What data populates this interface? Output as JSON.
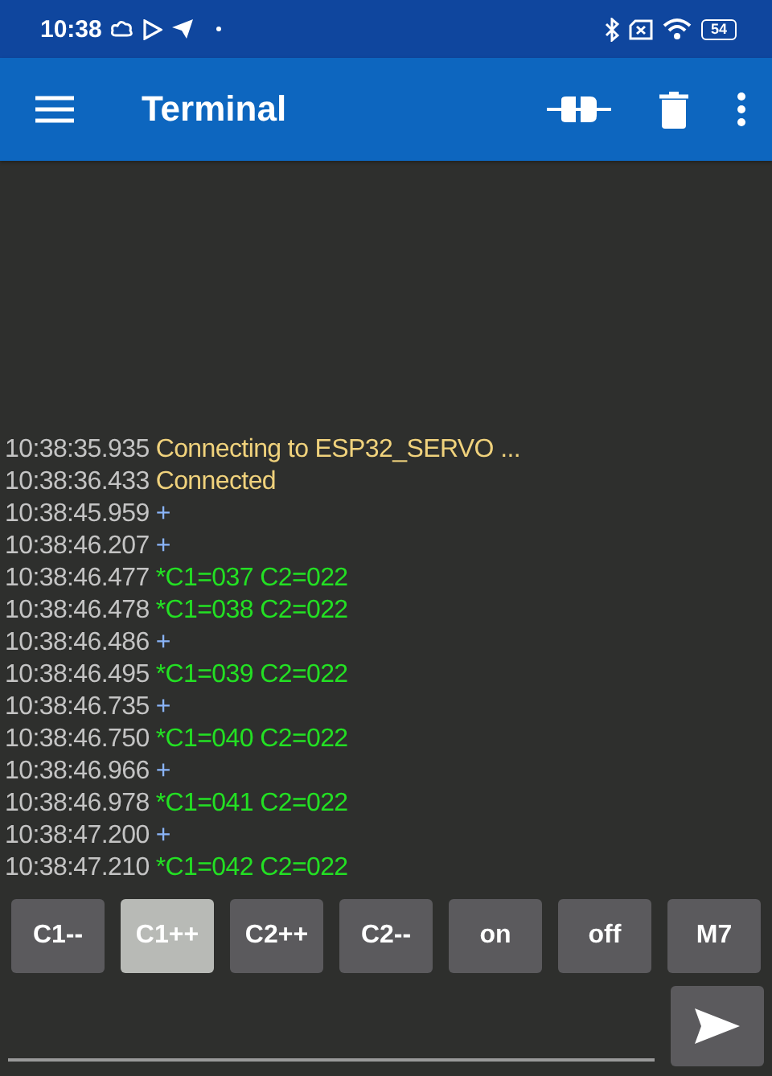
{
  "status_bar": {
    "time": "10:38",
    "battery": "54"
  },
  "toolbar": {
    "title": "Terminal"
  },
  "terminal": {
    "lines": [
      {
        "time": "10:38:35.935",
        "kind": "status",
        "text": "Connecting to ESP32_SERVO ..."
      },
      {
        "time": "10:38:36.433",
        "kind": "status",
        "text": "Connected"
      },
      {
        "time": "10:38:45.959",
        "kind": "sent",
        "text": "+"
      },
      {
        "time": "10:38:46.207",
        "kind": "sent",
        "text": "+"
      },
      {
        "time": "10:38:46.477",
        "kind": "received",
        "text": "*C1=037 C2=022"
      },
      {
        "time": "10:38:46.478",
        "kind": "received",
        "text": "*C1=038 C2=022"
      },
      {
        "time": "10:38:46.486",
        "kind": "sent",
        "text": "+"
      },
      {
        "time": "10:38:46.495",
        "kind": "received",
        "text": "*C1=039 C2=022"
      },
      {
        "time": "10:38:46.735",
        "kind": "sent",
        "text": "+"
      },
      {
        "time": "10:38:46.750",
        "kind": "received",
        "text": "*C1=040 C2=022"
      },
      {
        "time": "10:38:46.966",
        "kind": "sent",
        "text": "+"
      },
      {
        "time": "10:38:46.978",
        "kind": "received",
        "text": "*C1=041 C2=022"
      },
      {
        "time": "10:38:47.200",
        "kind": "sent",
        "text": "+"
      },
      {
        "time": "10:38:47.210",
        "kind": "received",
        "text": "*C1=042 C2=022"
      }
    ]
  },
  "macros": [
    {
      "label": "C1--",
      "selected": false
    },
    {
      "label": "C1++",
      "selected": true
    },
    {
      "label": "C2++",
      "selected": false
    },
    {
      "label": "C2--",
      "selected": false
    },
    {
      "label": "on",
      "selected": false
    },
    {
      "label": "off",
      "selected": false
    },
    {
      "label": "M7",
      "selected": false
    }
  ]
}
